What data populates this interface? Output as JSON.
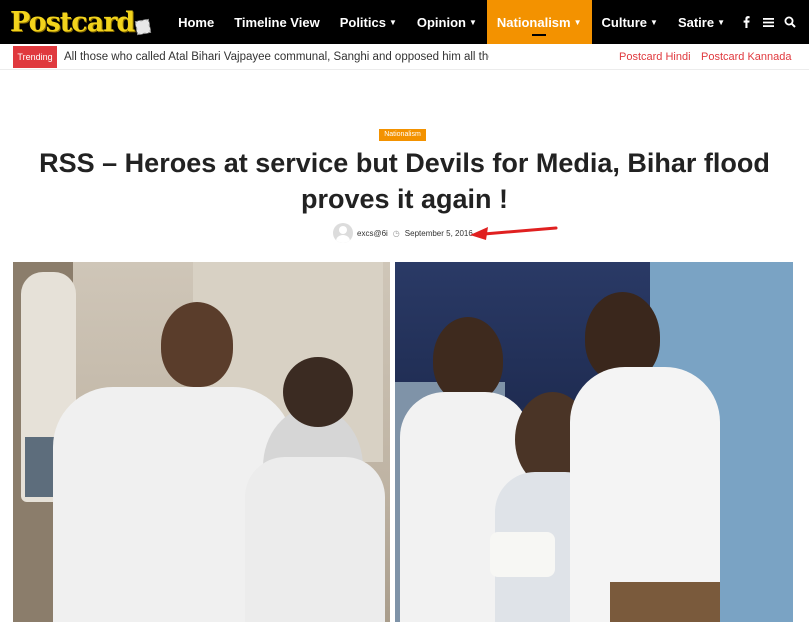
{
  "site": {
    "logo_text": "Postcard"
  },
  "nav": {
    "items": [
      {
        "label": "Home",
        "has_dropdown": false,
        "active": false
      },
      {
        "label": "Timeline View",
        "has_dropdown": false,
        "active": false
      },
      {
        "label": "Politics",
        "has_dropdown": true,
        "active": false
      },
      {
        "label": "Opinion",
        "has_dropdown": true,
        "active": false
      },
      {
        "label": "Nationalism",
        "has_dropdown": true,
        "active": true
      },
      {
        "label": "Culture",
        "has_dropdown": true,
        "active": false
      },
      {
        "label": "Satire",
        "has_dropdown": true,
        "active": false
      }
    ],
    "icons": [
      "facebook-icon",
      "menu-icon",
      "search-icon"
    ],
    "active_color": "#f39200"
  },
  "trending": {
    "badge": "Trending",
    "headline": "All those who called Atal Bihari Vajpayee communal, Sanghi and opposed him all their life, t",
    "links": [
      "Postcard Hindi",
      "Postcard Kannada"
    ],
    "accent_color": "#e0393e"
  },
  "article": {
    "category": "Nationalism",
    "title": "RSS – Heroes at service but Devils for Media, Bihar flood proves it again !",
    "author": "excs@6i",
    "date": "September 5, 2016"
  }
}
